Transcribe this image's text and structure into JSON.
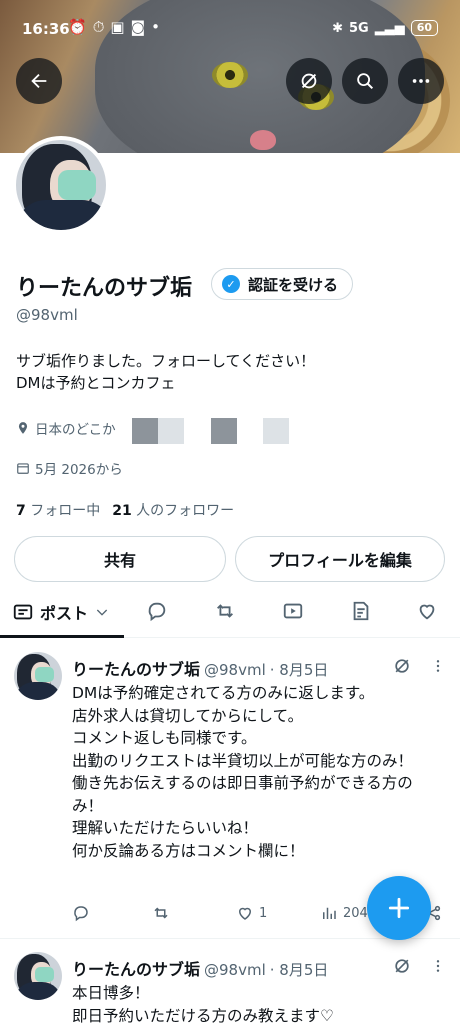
{
  "status_bar": {
    "time": "16:36",
    "network": "5G",
    "battery": "60"
  },
  "profile": {
    "display_name": "りーたんのサブ垢",
    "verify_button": "認証を受ける",
    "handle": "@98vml",
    "bio_line1": "サブ垢作りました。フォローしてください！",
    "bio_line2": "DMは予約とコンカフェ",
    "location": "日本のどこか",
    "joined": "5月 2026から",
    "following_count": "7",
    "following_label": "フォロー中",
    "followers_count": "21",
    "followers_label": "人のフォロワー",
    "share_button": "共有",
    "edit_profile_button": "プロフィールを編集"
  },
  "tabs": {
    "active_label": "ポスト"
  },
  "posts": [
    {
      "author": "りーたんのサブ垢",
      "handle": "@98vml",
      "date": "· 8月5日",
      "text": "DMは予約確定されてる方のみに返します。\n店外求人は貸切してからにして。\nコメント返しも同様です。\n出勤のリクエストは半貸切以上が可能な方のみ！\n働き先お伝えするのは即日事前予約ができる方のみ！\n理解いただけたらいいね！\n何か反論ある方はコメント欄に！",
      "likes": "1",
      "views": "204"
    },
    {
      "author": "りーたんのサブ垢",
      "handle": "@98vml",
      "date": "· 8月5日",
      "text": "本日博多！\n即日予約いただける方のみ教えます♡"
    }
  ],
  "colors": {
    "accent": "#1d9bf0",
    "text": "#0f1419",
    "muted": "#536471"
  }
}
